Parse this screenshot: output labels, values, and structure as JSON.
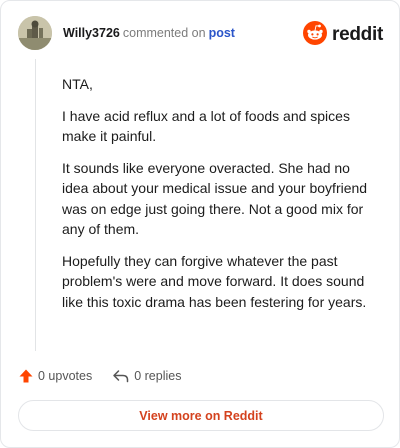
{
  "comment": {
    "username": "Willy3726",
    "action_text": "commented on",
    "post_link_text": "post",
    "paragraphs": [
      "NTA,",
      "I have acid reflux and a lot of foods and spices make it painful.",
      "It sounds like everyone overacted. She had no idea about your medical issue and your boyfriend was on edge just going there. Not a good mix for any of them.",
      "Hopefully they can forgive whatever the past problem's were and move forward. It does sound like this toxic drama has been festering for years."
    ]
  },
  "brand": {
    "name": "reddit",
    "icon": "reddit-logo-icon",
    "color": "#ff4500"
  },
  "actions": {
    "upvotes_label": "0 upvotes",
    "replies_label": "0 replies",
    "upvote_icon": "upvote-arrow-icon",
    "reply_icon": "reply-arrow-icon"
  },
  "view_more_label": "View more on Reddit",
  "colors": {
    "accent": "#d4421e",
    "link": "#2b55c9",
    "upvote": "#ff4500"
  }
}
